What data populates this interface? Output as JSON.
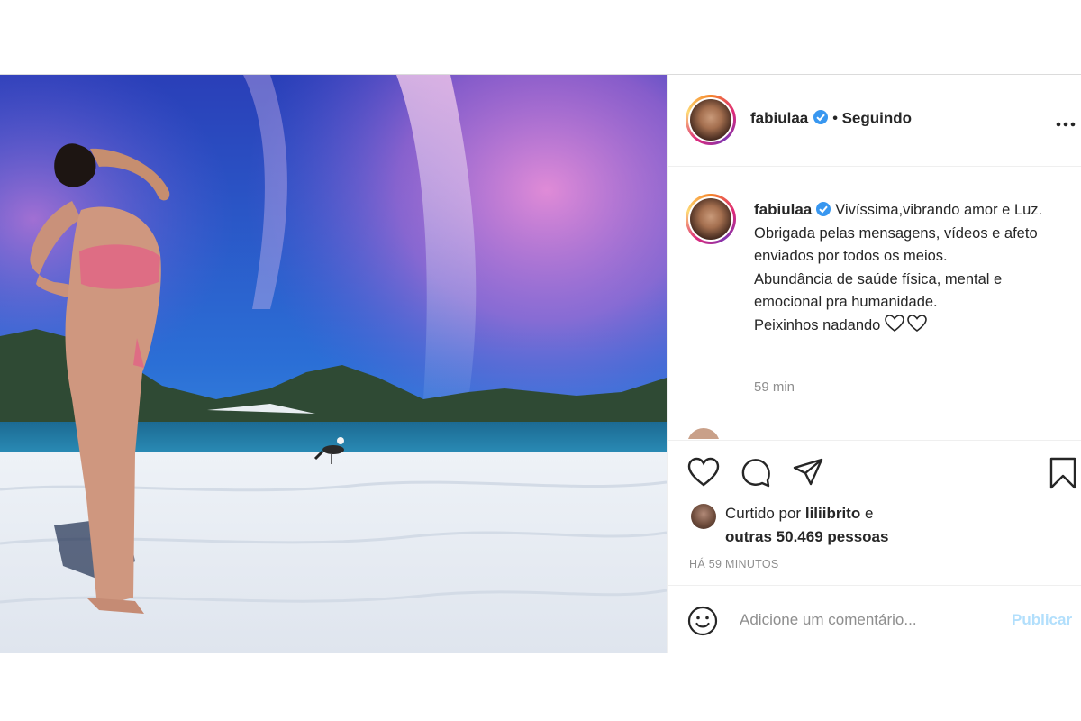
{
  "header": {
    "username": "fabiulaa",
    "separator": "•",
    "follow_status": "Seguindo",
    "more_icon": "more-dots-icon"
  },
  "caption": {
    "username": "fabiulaa",
    "line1": "Vivíssima,vibrando amor e Luz.",
    "line2": "Obrigada pelas mensagens, vídeos e afeto enviados por todos os meios.",
    "line3": "Abundância de saúde física, mental e emocional pra humanidade.",
    "line4": "Peixinhos nadando",
    "time": "59 min"
  },
  "actions": {
    "like_icon": "heart-icon",
    "comment_icon": "comment-icon",
    "share_icon": "send-icon",
    "save_icon": "bookmark-icon"
  },
  "likes": {
    "prefix": "Curtido por",
    "user": "liliibrito",
    "connector": "e",
    "others": "outras 50.469 pessoas"
  },
  "timestamp": "HÁ 59 MINUTOS",
  "comment": {
    "placeholder": "Adicione um comentário...",
    "publish_label": "Publicar",
    "emoji_icon": "emoji-icon"
  },
  "colors": {
    "verified": "#3897f0",
    "publish_disabled": "#b2dffc",
    "muted": "#8e8e8e"
  }
}
